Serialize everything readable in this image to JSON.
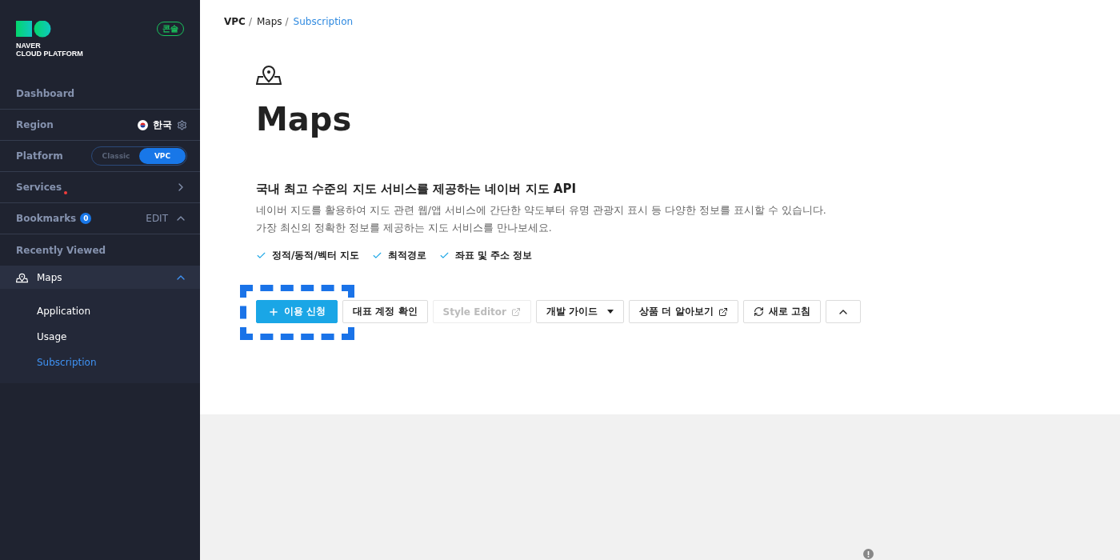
{
  "sidebar": {
    "logo": {
      "line1": "NAVER",
      "line2": "CLOUD PLATFORM"
    },
    "console_badge": "콘솔",
    "nav": [
      {
        "kind": "link",
        "label": "Dashboard"
      },
      {
        "kind": "region",
        "label": "Region",
        "value": "한국"
      },
      {
        "kind": "platform",
        "label": "Platform",
        "options": [
          {
            "label": "Classic",
            "selected": false
          },
          {
            "label": "VPC",
            "selected": true
          }
        ]
      },
      {
        "kind": "services",
        "label": "Services",
        "notification": true
      },
      {
        "kind": "bookmarks",
        "label": "Bookmarks",
        "count": "0",
        "action": "EDIT",
        "expanded": true
      },
      {
        "kind": "link",
        "label": "Recently Viewed"
      }
    ],
    "product": {
      "label": "Maps",
      "expanded": true,
      "children": [
        {
          "label": "Application",
          "selected": false
        },
        {
          "label": "Usage",
          "selected": false
        },
        {
          "label": "Subscription",
          "selected": true
        }
      ]
    }
  },
  "breadcrumb_separator": "/",
  "breadcrumb": [
    {
      "label": "VPC",
      "current": false
    },
    {
      "label": "Maps",
      "current": false
    },
    {
      "label": "Subscription",
      "current": true
    }
  ],
  "title": "Maps",
  "subtitle": "국내 최고 수준의 지도 서비스를 제공하는 네이버 지도 API",
  "description": [
    "네이버 지도를 활용하여 지도 관련 웹/앱 서비스에 간단한 약도부터 유명 관광지 표시 등 다양한 정보를 표시할 수 있습니다.",
    "가장 최신의 정확한 정보를 제공하는 지도 서비스를 만나보세요."
  ],
  "features": [
    "정적/동적/벡터 지도",
    "최적경로",
    "좌표 및 주소 정보"
  ],
  "buttons": [
    {
      "kind": "primary",
      "label": "이용 신청",
      "disabled": false,
      "highlighted": true
    },
    {
      "kind": "plain",
      "label": "대표 계정 확인",
      "disabled": false,
      "highlighted": false
    },
    {
      "kind": "external",
      "label": "Style Editor",
      "disabled": true,
      "highlighted": false
    },
    {
      "kind": "dropdown",
      "label": "개발 가이드",
      "disabled": false,
      "highlighted": false
    },
    {
      "kind": "external",
      "label": "상품 더 알아보기",
      "disabled": false,
      "highlighted": false
    },
    {
      "kind": "refresh",
      "label": "새로 고침",
      "disabled": false,
      "highlighted": false
    },
    {
      "kind": "collapse",
      "disabled": false,
      "highlighted": false
    }
  ]
}
